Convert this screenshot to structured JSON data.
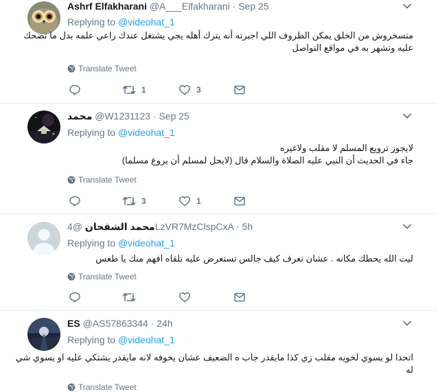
{
  "tweets": [
    {
      "name": "Ashrf Elfakharani",
      "handle": "@A___Elfakharani",
      "separator": "·",
      "time": "Sep 25",
      "replying_label": "Replying to",
      "replying_to": "@videohat_1",
      "lines": [
        "متسخروش من الخلق يمكن الظروف اللي اجبرته أنه يترك أهله يجي يشتغل عندك راعي علمه بدل ما تضحك",
        "عليه وتشهر به في مواقع التواصل"
      ],
      "translate_label": "Translate Tweet",
      "reply_count": "",
      "retweet_count": "1",
      "like_count": "3",
      "avatar": "owl-avatar"
    },
    {
      "name": "محمد",
      "handle": "@W1231123",
      "separator": "·",
      "time": "Sep 25",
      "replying_label": "Replying to",
      "replying_to": "@videohat_1",
      "lines": [
        "لايجوز ترويع المسلم لا مقلب ولاغيره",
        "جاء في الحديث أن النبي عليه الصلاة والسلام قال (لايحل لمسلم أن يروع مسلما)"
      ],
      "translate_label": "Translate Tweet",
      "reply_count": "",
      "retweet_count": "3",
      "like_count": "1",
      "avatar": "night-avatar"
    },
    {
      "name": "محمد الشقحان",
      "handle": "@4LzVR7MzClspCxA",
      "separator": "·",
      "time": "5h",
      "replying_label": "Replying to",
      "replying_to": "@videohat_1",
      "lines": [
        "ليت الله يحطك مكانه . عشان تعرف كيف جالس تستعرض عليه تلقاه افهم منك يا طعس"
      ],
      "translate_label": "Translate Tweet",
      "reply_count": "",
      "retweet_count": "",
      "like_count": "",
      "avatar": "default-avatar"
    },
    {
      "name": "ES",
      "handle": "@AS57863344",
      "separator": "·",
      "time": "24h",
      "replying_label": "Replying to",
      "replying_to": "@videohat_1",
      "lines": [
        "اتحدا لو يسوي لخويه مقلب زي كذا مايقدر جاب ه الضعيف عشان يخوفه لانه مايقدر يشتكي عليه او يسوي شي",
        "له"
      ],
      "translate_label": "Translate Tweet",
      "reply_count": "",
      "retweet_count": "",
      "like_count": "",
      "avatar": "road-avatar"
    }
  ],
  "colors": {
    "accent": "#1da1f2",
    "muted": "#657786",
    "text": "#14171a",
    "divider": "#e6ecf0"
  }
}
